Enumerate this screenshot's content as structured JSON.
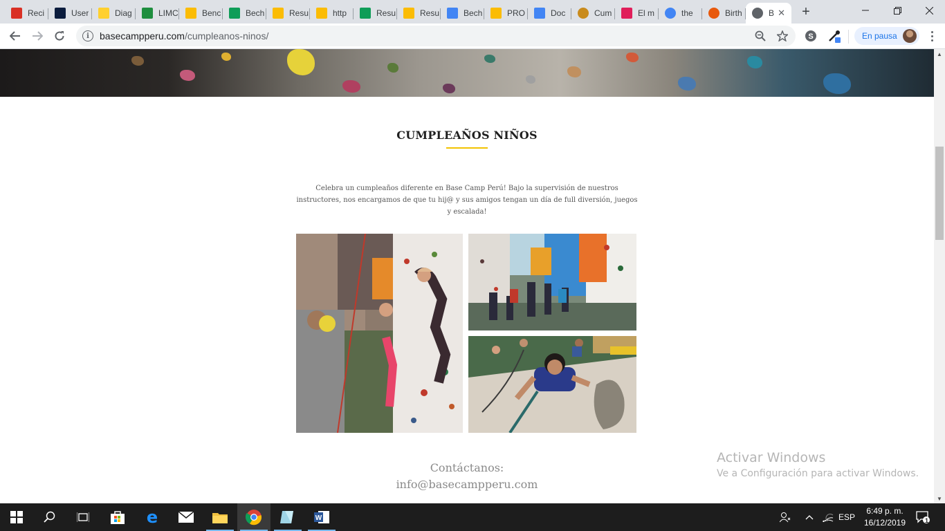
{
  "browser": {
    "tabs": [
      {
        "label": "Reci",
        "icon": "gmail-icon",
        "color": "#d93025"
      },
      {
        "label": "User",
        "icon": "x-app-icon",
        "color": "#0b1c3d"
      },
      {
        "label": "Diag",
        "icon": "miro-icon",
        "color": "#ffd02f"
      },
      {
        "label": "LIMC",
        "icon": "classroom-icon",
        "color": "#1e8e3e"
      },
      {
        "label": "Benc",
        "icon": "drive-icon",
        "color": "#fbbc04"
      },
      {
        "label": "Bech",
        "icon": "sheets-icon",
        "color": "#0f9d58"
      },
      {
        "label": "Resu",
        "icon": "drive-icon",
        "color": "#fbbc04"
      },
      {
        "label": "http",
        "icon": "drive-icon",
        "color": "#fbbc04"
      },
      {
        "label": "Resu",
        "icon": "sheets-icon",
        "color": "#0f9d58"
      },
      {
        "label": "Resu",
        "icon": "drive-icon",
        "color": "#fbbc04"
      },
      {
        "label": "Bech",
        "icon": "docs-icon",
        "color": "#4285f4"
      },
      {
        "label": "PRO",
        "icon": "drive-icon",
        "color": "#fbbc04"
      },
      {
        "label": "Doc",
        "icon": "docs-icon",
        "color": "#4285f4"
      },
      {
        "label": "Cum",
        "icon": "site-icon",
        "color": "#c98b1c"
      },
      {
        "label": "El m",
        "icon": "slack-icon",
        "color": "#e01e5a"
      },
      {
        "label": "the",
        "icon": "google-icon",
        "color": "#4285f4"
      },
      {
        "label": "Birth",
        "icon": "firefox-like-icon",
        "color": "#e8590c"
      },
      {
        "label": "B",
        "icon": "globe-icon",
        "color": "#5f6368"
      }
    ],
    "new_tab_label": "+",
    "url_domain": "basecampperu.com",
    "url_path": "/cumpleanos-ninos/",
    "profile_status": "En pausa"
  },
  "page": {
    "title": "CUMPLEAÑOS NIÑOS",
    "intro": "Celebra un cumpleaños diferente en Base Camp Perú! Bajo la supervisión de nuestros instructores, nos encargamos de que tu hij@ y sus amigos tengan un día de full diversión, juegos y  escalada!",
    "contact_label": "Contáctanos:",
    "contact_email": "info@basecampperu.com",
    "accent_color": "#f2c200"
  },
  "watermark": {
    "line1": "Activar Windows",
    "line2": "Ve a Configuración para activar Windows."
  },
  "taskbar": {
    "language": "ESP",
    "time": "6:49 p. m.",
    "date": "16/12/2019",
    "notification_count": "1"
  }
}
